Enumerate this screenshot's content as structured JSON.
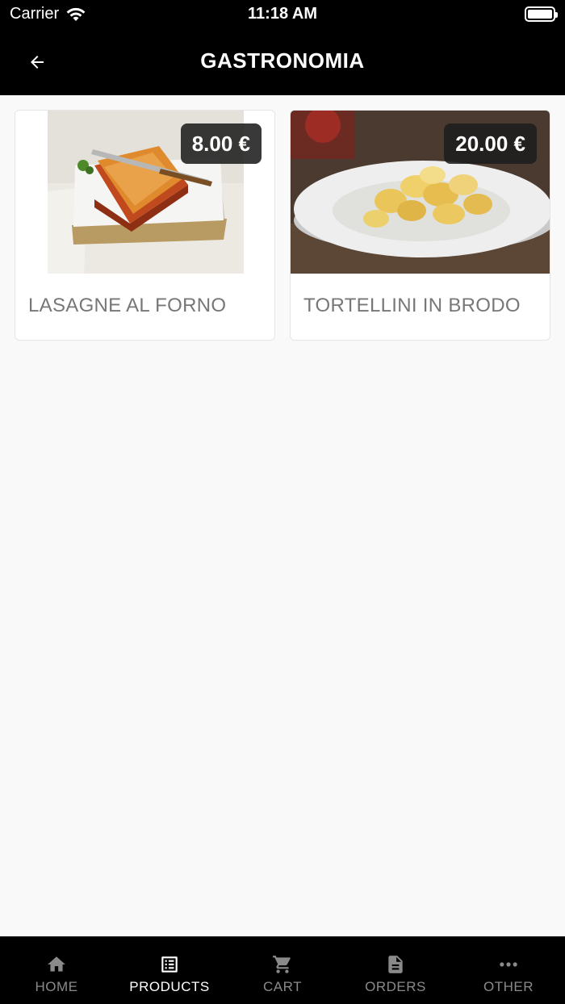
{
  "status_bar": {
    "carrier": "Carrier",
    "time": "11:18 AM"
  },
  "header": {
    "title": "GASTRONOMIA",
    "back_icon": "arrow-left-icon"
  },
  "products": [
    {
      "name": "LASAGNE AL FORNO",
      "price": "8.00 €",
      "image": "lasagne-photo"
    },
    {
      "name": "TORTELLINI IN BRODO",
      "price": "20.00 €",
      "image": "tortellini-photo"
    }
  ],
  "tabs": [
    {
      "label": "HOME",
      "icon": "home-icon",
      "active": false
    },
    {
      "label": "PRODUCTS",
      "icon": "list-icon",
      "active": true
    },
    {
      "label": "CART",
      "icon": "cart-icon",
      "active": false
    },
    {
      "label": "ORDERS",
      "icon": "document-icon",
      "active": false
    },
    {
      "label": "OTHER",
      "icon": "more-icon",
      "active": false
    }
  ],
  "colors": {
    "bar_background": "#000000",
    "page_background": "#f9f9f9",
    "active_tab": "#ffffff",
    "inactive_tab": "#8a8a8a",
    "product_name": "#777777"
  }
}
